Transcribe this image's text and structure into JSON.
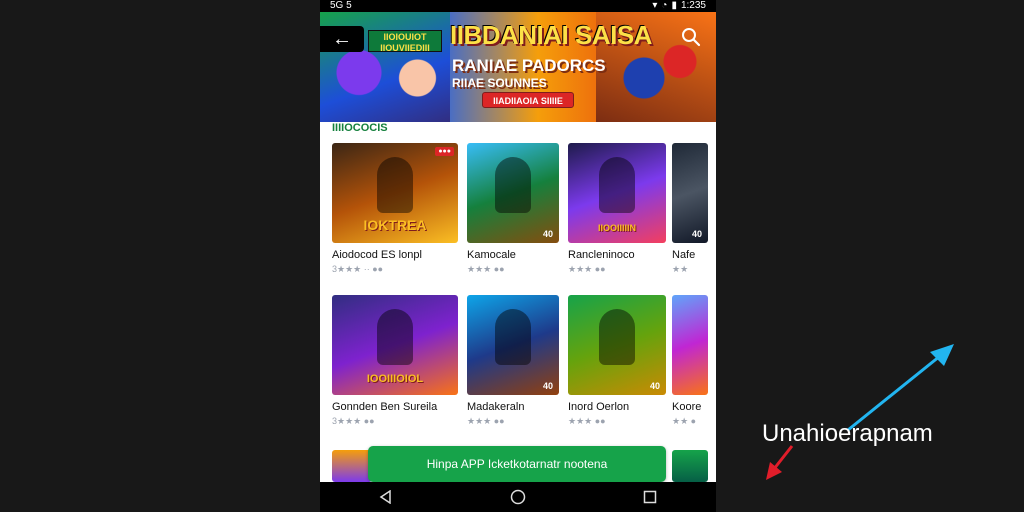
{
  "status_bar": {
    "left_text": "5G 5",
    "time": "1:235"
  },
  "banner": {
    "tag": "IIOIOUIOT IIOUVIIEDIII",
    "title": "IIBDANIAI SAISA",
    "subtitle": "RANIAE PADORCS",
    "subtitle2": "RIIAE SOUNNES",
    "pill": "IIADIIAOIA SIIIIE",
    "back_icon": "back-arrow-icon",
    "search_icon": "search-icon"
  },
  "section": {
    "title": "IIIIOCOCIS"
  },
  "grid": [
    {
      "title": "Aiodocod ES lonpl",
      "meta": "3★★★ ·· ●●",
      "badge": "●●●",
      "logo": "IOKTREA",
      "thumb": [
        "#3b2615",
        "#b45309",
        "#fbbf24"
      ]
    },
    {
      "title": "Kamocale",
      "meta": "★★★ ●●",
      "badge": "",
      "logo": "",
      "corner": "40",
      "thumb": [
        "#38bdf8",
        "#15803d",
        "#854d0e"
      ]
    },
    {
      "title": "Rancleninoco",
      "meta": "★★★ ●●",
      "badge": "",
      "logo": "IIOOIIIIIN",
      "thumb": [
        "#1e1b4b",
        "#7c3aed",
        "#f43f5e"
      ]
    },
    {
      "title": "Nafe",
      "meta": "★★",
      "badge": "",
      "logo": "",
      "corner": "40",
      "thumb": [
        "#1f2937",
        "#4b5563",
        "#111827"
      ]
    },
    {
      "title": "Gonnden Ben Sureila",
      "meta": "3★★★ ●●",
      "badge": "",
      "logo": "IOOIIIOIOL",
      "thumb": [
        "#312e81",
        "#7e22ce",
        "#f97316"
      ]
    },
    {
      "title": "Madakeraln",
      "meta": "★★★ ●●",
      "badge": "",
      "logo": "",
      "corner": "40",
      "thumb": [
        "#0ea5e9",
        "#1e3a8a",
        "#92400e"
      ]
    },
    {
      "title": "Inord Oerlon",
      "meta": "★★★ ●●",
      "badge": "",
      "logo": "",
      "corner": "40",
      "thumb": [
        "#16a34a",
        "#65a30d",
        "#ca8a04"
      ]
    },
    {
      "title": "Koore",
      "meta": "★★ ●",
      "badge": "",
      "logo": "",
      "corner": "",
      "thumb": [
        "#60a5fa",
        "#c026d3",
        "#f97316"
      ]
    }
  ],
  "cta": {
    "label": "Hinpa APP Icketkotarnatr nootena"
  },
  "nav": {
    "back_icon": "nav-back-icon",
    "home_icon": "nav-home-icon",
    "recents_icon": "nav-recents-icon"
  },
  "annotation": {
    "label": "Unahioerapnam"
  },
  "colors": {
    "accent_green": "#16a34a",
    "arrow_blue": "#22b5f0",
    "arrow_red": "#e11d2a"
  }
}
